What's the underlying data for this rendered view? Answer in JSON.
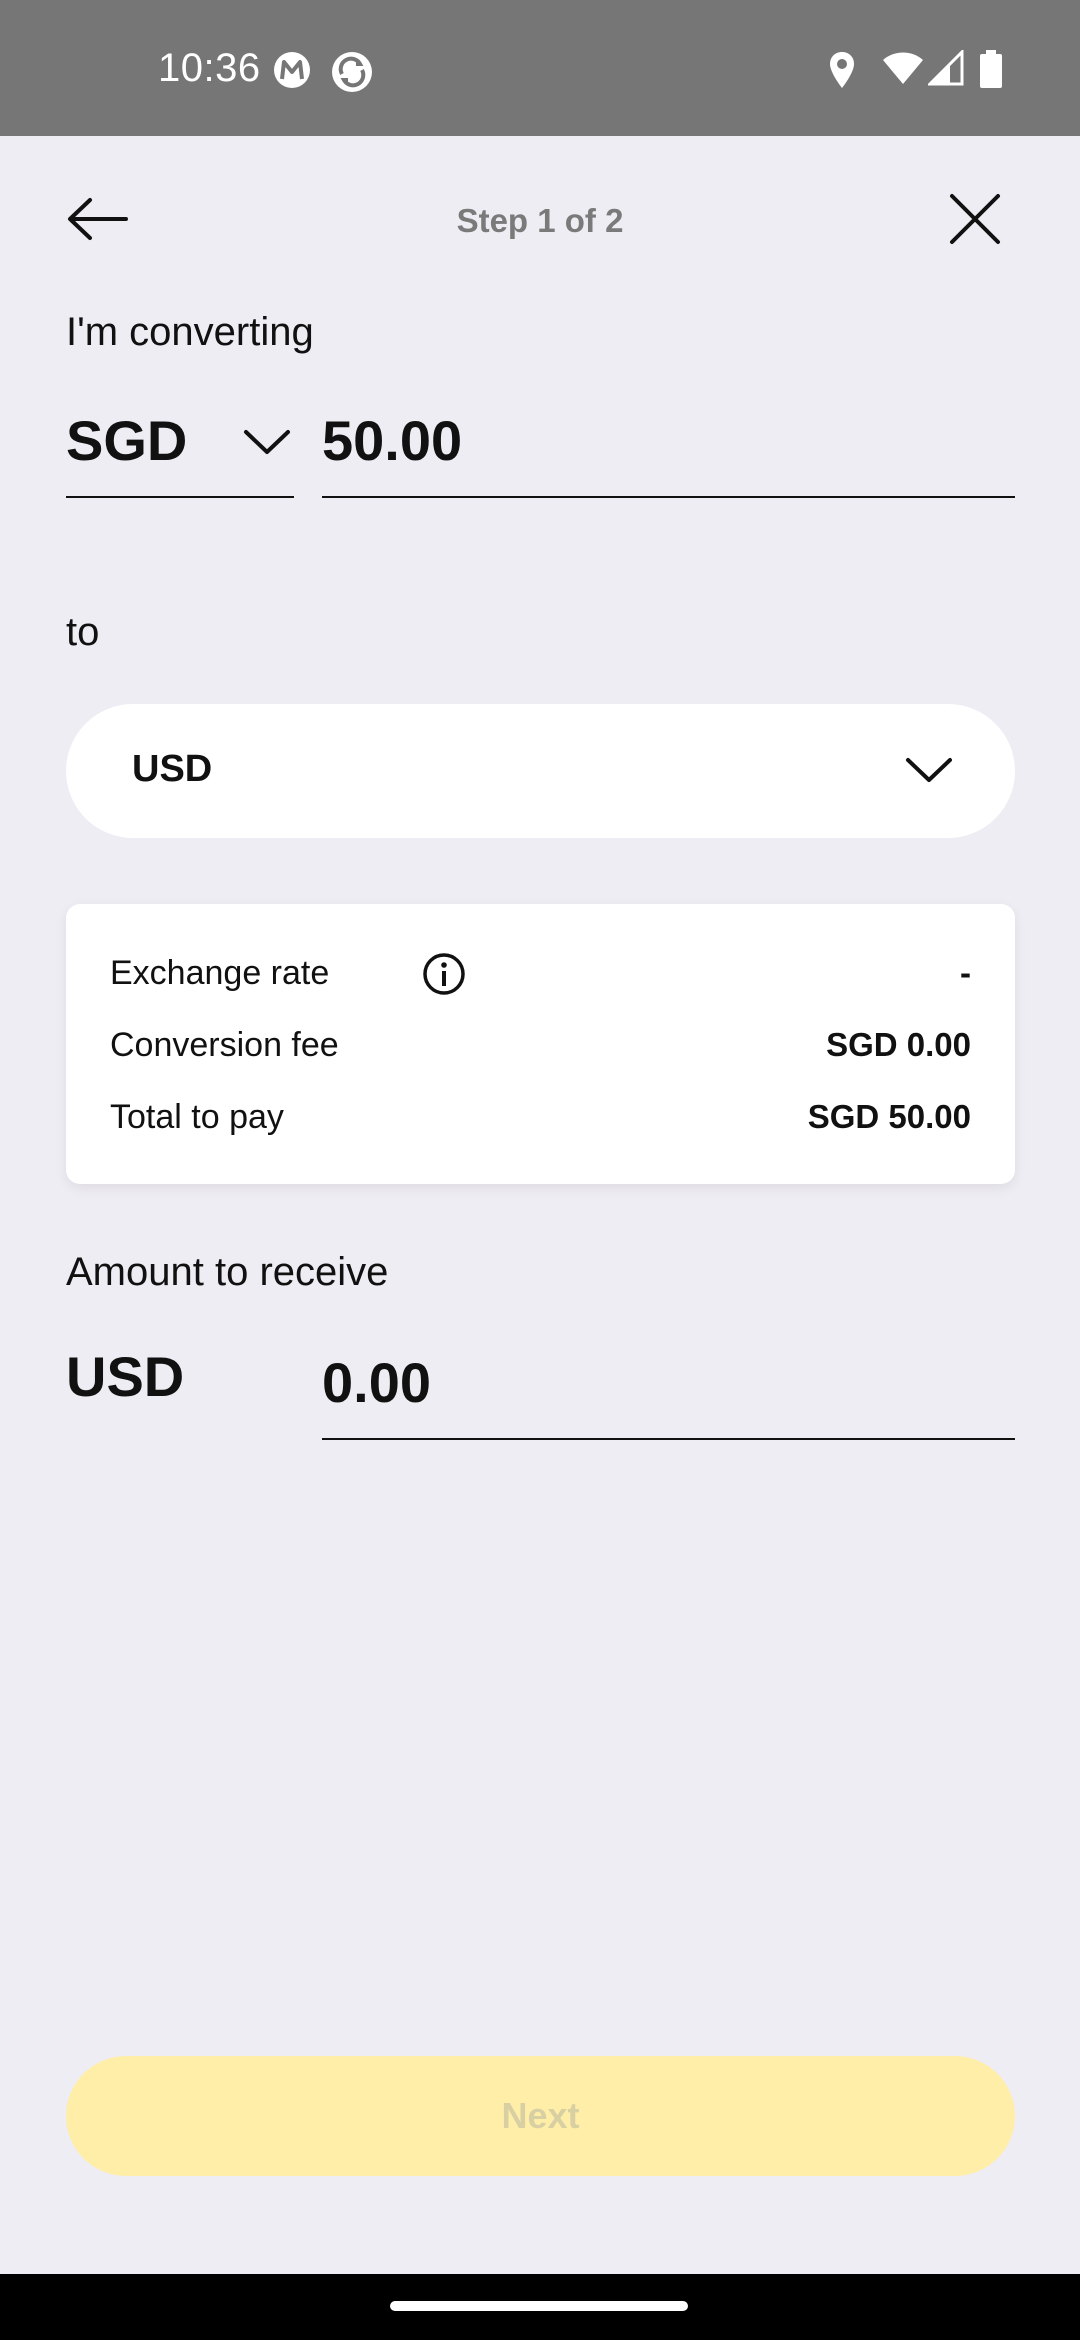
{
  "status_bar": {
    "time": "10:36"
  },
  "header": {
    "step": "Step 1 of 2"
  },
  "convert": {
    "label": "I'm converting",
    "from_currency": "SGD",
    "amount": "50.00"
  },
  "to": {
    "label": "to",
    "currency": "USD"
  },
  "summary": {
    "exchange_rate_label": "Exchange rate",
    "exchange_rate_value": "-",
    "fee_label": "Conversion fee",
    "fee_value": "SGD 0.00",
    "total_label": "Total to pay",
    "total_value": "SGD 50.00"
  },
  "receive": {
    "label": "Amount to receive",
    "currency": "USD",
    "amount": "0.00"
  },
  "actions": {
    "next_label": "Next"
  },
  "colors": {
    "background": "#eeedf3",
    "status_bar": "#767676",
    "next_button_disabled": "#ffeea8",
    "next_text_disabled": "#d8cfa3"
  }
}
